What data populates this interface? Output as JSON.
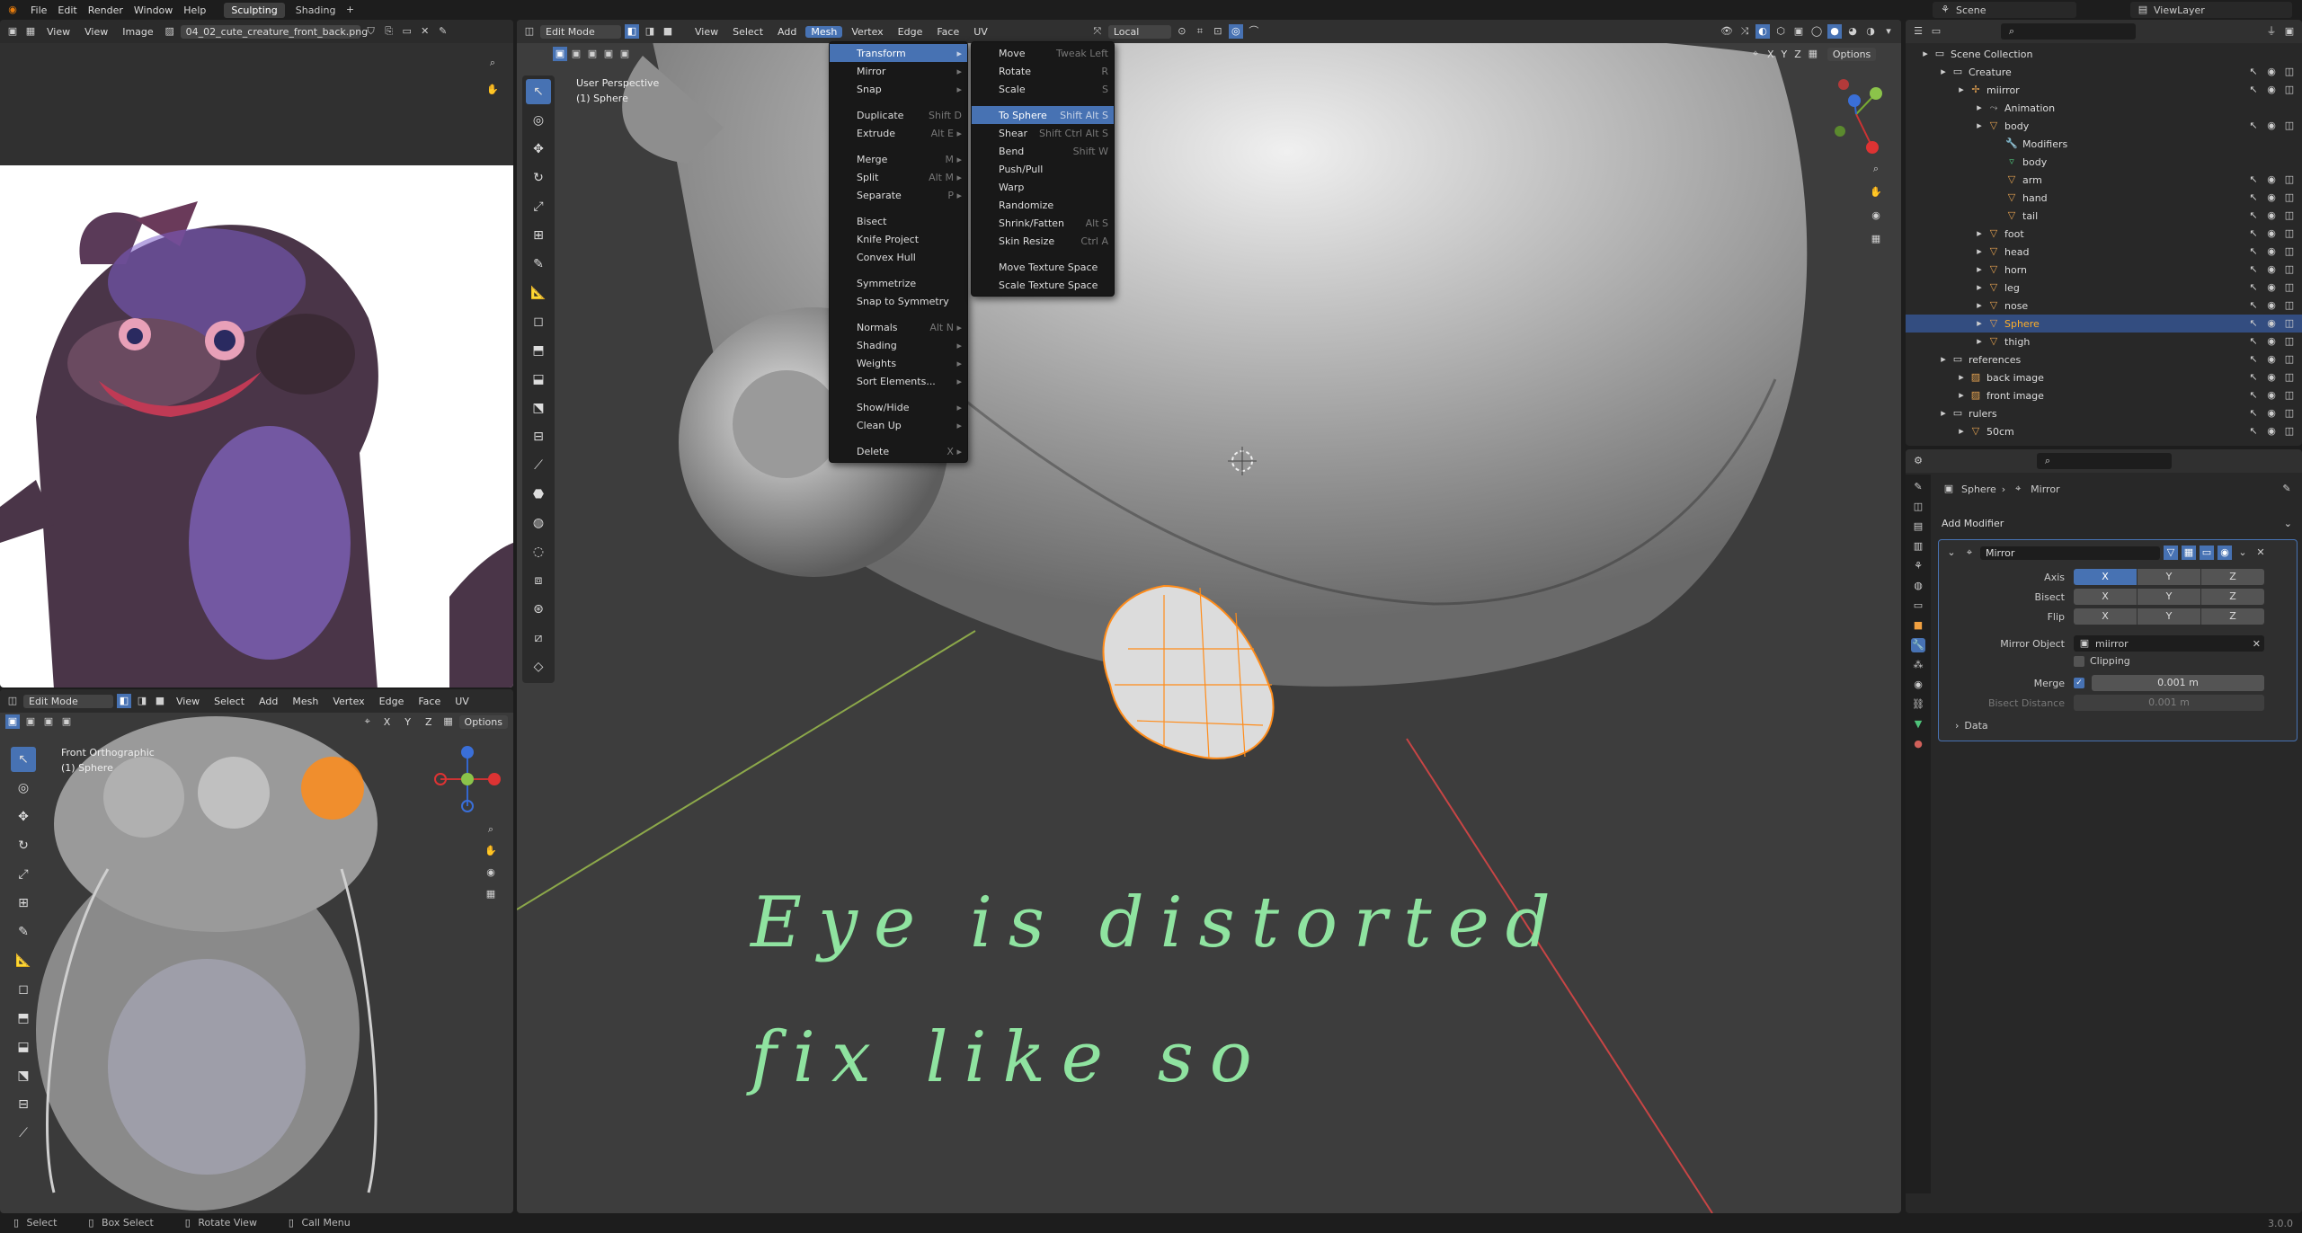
{
  "topbar": {
    "menus": [
      "File",
      "Edit",
      "Render",
      "Window",
      "Help"
    ],
    "workspaces": [
      "Sculpting",
      "Shading"
    ],
    "scene": "Scene",
    "view_layer": "ViewLayer"
  },
  "image_editor": {
    "menus": [
      "View",
      "View",
      "Image"
    ],
    "image_name": "04_02_cute_creature_front_back.png"
  },
  "viewport_left": {
    "mode": "Edit Mode",
    "menus": [
      "View",
      "Select",
      "Add",
      "Mesh",
      "Vertex",
      "Edge",
      "Face",
      "UV"
    ],
    "options": "Options",
    "overlay_title": "Front Orthographic",
    "overlay_object": "(1) Sphere",
    "axes": [
      "X",
      "Y",
      "Z"
    ]
  },
  "viewport_main": {
    "mode": "Edit Mode",
    "menus": [
      "View",
      "Select",
      "Add",
      "Mesh",
      "Vertex",
      "Edge",
      "Face",
      "UV"
    ],
    "active_menu": "Mesh",
    "pivot": "Local",
    "options": "Options",
    "overlay_title": "User Perspective",
    "overlay_object": "(1) Sphere",
    "axes": [
      "X",
      "Y",
      "Z"
    ],
    "handwritten_note": [
      "Eye is distorted",
      "fix like so"
    ]
  },
  "mesh_menu": {
    "items": [
      {
        "label": "Transform",
        "shortcut": "",
        "submenu": true,
        "highlight": true
      },
      {
        "label": "Mirror",
        "shortcut": "",
        "submenu": true
      },
      {
        "label": "Snap",
        "shortcut": "",
        "submenu": true
      },
      {
        "sep": true
      },
      {
        "label": "Duplicate",
        "shortcut": "Shift D"
      },
      {
        "label": "Extrude",
        "shortcut": "Alt E",
        "submenu": true
      },
      {
        "sep": true
      },
      {
        "label": "Merge",
        "shortcut": "M",
        "submenu": true
      },
      {
        "label": "Split",
        "shortcut": "Alt M",
        "submenu": true
      },
      {
        "label": "Separate",
        "shortcut": "P",
        "submenu": true
      },
      {
        "sep": true
      },
      {
        "label": "Bisect",
        "shortcut": ""
      },
      {
        "label": "Knife Project",
        "shortcut": ""
      },
      {
        "label": "Convex Hull",
        "shortcut": ""
      },
      {
        "sep": true
      },
      {
        "label": "Symmetrize",
        "shortcut": ""
      },
      {
        "label": "Snap to Symmetry",
        "shortcut": ""
      },
      {
        "sep": true
      },
      {
        "label": "Normals",
        "shortcut": "Alt N",
        "submenu": true
      },
      {
        "label": "Shading",
        "shortcut": "",
        "submenu": true
      },
      {
        "label": "Weights",
        "shortcut": "",
        "submenu": true
      },
      {
        "label": "Sort Elements...",
        "shortcut": "",
        "submenu": true
      },
      {
        "sep": true
      },
      {
        "label": "Show/Hide",
        "shortcut": "",
        "submenu": true
      },
      {
        "label": "Clean Up",
        "shortcut": "",
        "submenu": true
      },
      {
        "sep": true
      },
      {
        "label": "Delete",
        "shortcut": "X",
        "submenu": true
      }
    ]
  },
  "transform_menu": {
    "items": [
      {
        "label": "Move",
        "shortcut": "Tweak Left"
      },
      {
        "label": "Rotate",
        "shortcut": "R"
      },
      {
        "label": "Scale",
        "shortcut": "S"
      },
      {
        "sep": true
      },
      {
        "label": "To Sphere",
        "shortcut": "Shift Alt S",
        "highlight": true
      },
      {
        "label": "Shear",
        "shortcut": "Shift Ctrl Alt S"
      },
      {
        "label": "Bend",
        "shortcut": "Shift W"
      },
      {
        "label": "Push/Pull",
        "shortcut": ""
      },
      {
        "label": "Warp",
        "shortcut": ""
      },
      {
        "label": "Randomize",
        "shortcut": ""
      },
      {
        "label": "Shrink/Fatten",
        "shortcut": "Alt S"
      },
      {
        "label": "Skin Resize",
        "shortcut": "Ctrl A"
      },
      {
        "sep": true
      },
      {
        "label": "Move Texture Space",
        "shortcut": ""
      },
      {
        "label": "Scale Texture Space",
        "shortcut": ""
      }
    ]
  },
  "outliner": {
    "rows": [
      {
        "label": "Scene Collection",
        "depth": 0,
        "icon": "collection-icon"
      },
      {
        "label": "Creature",
        "depth": 1,
        "icon": "collection-icon"
      },
      {
        "label": "miirror",
        "depth": 2,
        "icon": "empty-icon"
      },
      {
        "label": "Animation",
        "depth": 3,
        "icon": "animation-icon"
      },
      {
        "label": "body",
        "depth": 3,
        "icon": "mesh-icon"
      },
      {
        "label": "Modifiers",
        "depth": 4,
        "icon": "wrench-icon"
      },
      {
        "label": "body",
        "depth": 4,
        "icon": "mesh-data-icon"
      },
      {
        "label": "arm",
        "depth": 4,
        "icon": "mesh-icon"
      },
      {
        "label": "hand",
        "depth": 4,
        "icon": "mesh-icon"
      },
      {
        "label": "tail",
        "depth": 4,
        "icon": "mesh-icon"
      },
      {
        "label": "foot",
        "depth": 3,
        "icon": "mesh-icon"
      },
      {
        "label": "head",
        "depth": 3,
        "icon": "mesh-icon"
      },
      {
        "label": "horn",
        "depth": 3,
        "icon": "mesh-icon"
      },
      {
        "label": "leg",
        "depth": 3,
        "icon": "mesh-icon"
      },
      {
        "label": "nose",
        "depth": 3,
        "icon": "mesh-icon"
      },
      {
        "label": "Sphere",
        "depth": 3,
        "icon": "mesh-icon",
        "selected": true
      },
      {
        "label": "thigh",
        "depth": 3,
        "icon": "mesh-icon"
      },
      {
        "label": "references",
        "depth": 1,
        "icon": "collection-icon"
      },
      {
        "label": "back image",
        "depth": 2,
        "icon": "image-icon"
      },
      {
        "label": "front image",
        "depth": 2,
        "icon": "image-icon"
      },
      {
        "label": "rulers",
        "depth": 1,
        "icon": "collection-icon"
      },
      {
        "label": "50cm",
        "depth": 2,
        "icon": "mesh-icon"
      }
    ]
  },
  "properties": {
    "breadcrumb_object": "Sphere",
    "breadcrumb_modifier": "Mirror",
    "add_modifier": "Add Modifier",
    "modifier_name": "Mirror",
    "axis_label": "Axis",
    "bisect_label": "Bisect",
    "flip_label": "Flip",
    "xyz": [
      "X",
      "Y",
      "Z"
    ],
    "mirror_object_label": "Mirror Object",
    "mirror_object_value": "miirror",
    "clipping_label": "Clipping",
    "merge_label": "Merge",
    "merge_value": "0.001 m",
    "bisect_distance_label": "Bisect Distance",
    "bisect_distance_value": "0.001 m",
    "data_label": "Data"
  },
  "statusbar": {
    "items": [
      "Select",
      "Box Select",
      "Rotate View",
      "Call Menu"
    ],
    "version": "3.0.0"
  },
  "colors": {
    "accent": "#4772b3",
    "selection_orange": "#ff8c1a",
    "note_green": "#8fe3a0"
  }
}
